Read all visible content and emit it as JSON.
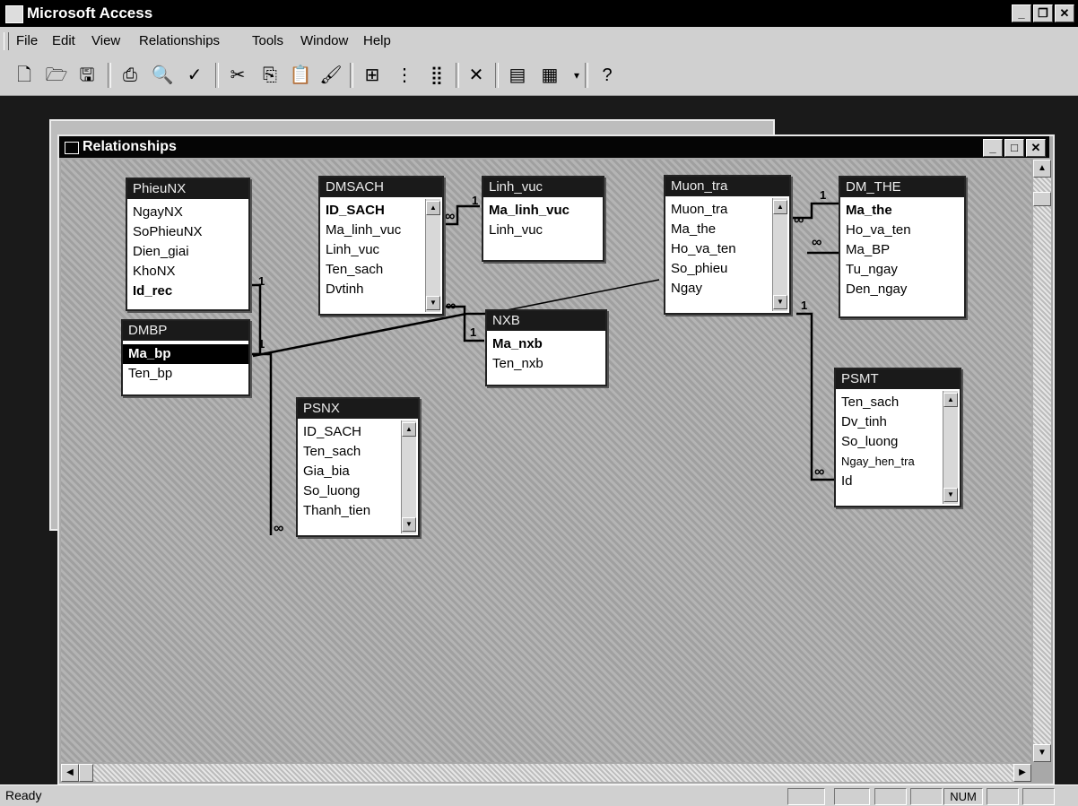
{
  "app": {
    "title": "Microsoft Access"
  },
  "menu": [
    "File",
    "Edit",
    "View",
    "Relationships",
    "Tools",
    "Window",
    "Help"
  ],
  "toolbar_icons": [
    "new-icon",
    "open-icon",
    "save-icon",
    "print-icon",
    "print-preview-icon",
    "spelling-icon",
    "cut-icon",
    "copy-icon",
    "paste-icon",
    "format-painter-icon",
    "show-table-icon",
    "show-direct-icon",
    "show-all-icon",
    "delete-icon",
    "properties-icon",
    "new-object-icon",
    "help-icon"
  ],
  "window": {
    "title": "Relationships"
  },
  "tables": {
    "phieunx": {
      "name": "PhieuNX",
      "fields": [
        "NgayNX",
        "SoPhieuNX",
        "Dien_giai",
        "KhoNX",
        "Id_rec"
      ],
      "key": 4
    },
    "dmbp": {
      "name": "DMBP",
      "fields": [
        "Ma_bp",
        "Ten_bp"
      ],
      "key": 0
    },
    "dmsach": {
      "name": "DMSACH",
      "fields": [
        "ID_SACH",
        "Ma_linh_vuc",
        "Linh_vuc",
        "Ten_sach",
        "Dvtinh"
      ],
      "key": 0
    },
    "linh_vuc": {
      "name": "Linh_vuc",
      "fields": [
        "Ma_linh_vuc",
        "Linh_vuc"
      ],
      "key": 0
    },
    "nxb": {
      "name": "NXB",
      "fields": [
        "Ma_nxb",
        "Ten_nxb"
      ],
      "key": 0
    },
    "muon_tra": {
      "name": "Muon_tra",
      "fields": [
        "Muon_tra",
        "Ma_the",
        "Ho_va_ten",
        "So_phieu",
        "Ngay"
      ],
      "key": -1
    },
    "dm_the": {
      "name": "DM_THE",
      "fields": [
        "Ma_the",
        "Ho_va_ten",
        "Ma_BP",
        "Tu_ngay",
        "Den_ngay"
      ],
      "key": 0
    },
    "psnx": {
      "name": "PSNX",
      "fields": [
        "ID_SACH",
        "Ten_sach",
        "Gia_bia",
        "So_luong",
        "Thanh_tien"
      ],
      "key": -1
    },
    "psmt": {
      "name": "PSMT",
      "fields": [
        "Ten_sach",
        "Dv_tinh",
        "So_luong",
        "Ngay_hen_tra",
        "Id"
      ],
      "key": -1
    }
  },
  "relation_labels": {
    "one": "1",
    "many": "∞"
  },
  "status": {
    "text": "Ready",
    "num": "NUM"
  }
}
